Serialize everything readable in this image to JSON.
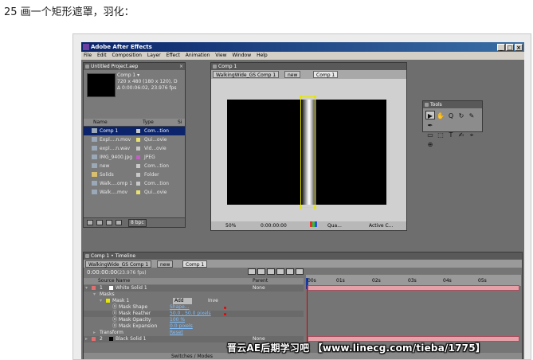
{
  "caption": "25 画一个矩形遮罩，羽化：",
  "app": {
    "title": "Adobe After Effects",
    "window_buttons": [
      "_",
      "□",
      "×"
    ],
    "menu": [
      "File",
      "Edit",
      "Composition",
      "Layer",
      "Effect",
      "Animation",
      "View",
      "Window",
      "Help"
    ]
  },
  "project": {
    "title": "Untitled Project.aep",
    "close": "×",
    "selected_name": "Comp 1 ▾",
    "info_lines": [
      "720 x 480  (180 x 120), D",
      "Δ 0:00:06:02, 23.976 fps"
    ],
    "columns": [
      "Name",
      "Type",
      "Si"
    ],
    "items": [
      {
        "name": "Comp 1",
        "type": "Com...tion",
        "label_color": "#c8c8c8"
      },
      {
        "name": "Expl....n.mov",
        "type": "Qui...ovie",
        "label_color": "#e8e070"
      },
      {
        "name": "expl....n.wav",
        "type": "Vid...ovie",
        "label_color": "#c8c8c8"
      },
      {
        "name": "IMG_9400.jpg",
        "type": "JPEG",
        "label_color": "#c060c0"
      },
      {
        "name": "new",
        "type": "Com...tion",
        "label_color": "#c8c8c8"
      },
      {
        "name": "Solids",
        "type": "Folder",
        "label_color": "#c8c8c8"
      },
      {
        "name": "Walk....omp 1",
        "type": "Com...tion",
        "label_color": "#c8c8c8"
      },
      {
        "name": "Walk....mov",
        "type": "Qui...ovie",
        "label_color": "#e8e070"
      }
    ],
    "bpc": "8 bpc"
  },
  "viewer": {
    "title": "Comp 1",
    "tabs": [
      "WalkingWide_GS Comp 1",
      "new",
      "Comp 1"
    ],
    "zoom": "50%",
    "timecode": "0:00:00:00",
    "resolution": "Qua...",
    "camera": "Active C..."
  },
  "tools": {
    "title": "Tools",
    "icons": [
      "▶",
      "✋",
      "Q",
      "↻",
      "✎",
      "✒",
      "▭",
      "⬚",
      "T",
      "✍",
      "⌖",
      "⊕"
    ]
  },
  "timeline": {
    "title": "Comp 1 • Timeline",
    "tabs": [
      "WalkingWide_GS Comp 1",
      "new",
      "Comp 1"
    ],
    "timecode": "0:00:00:00",
    "fps": "(23.976 fps)",
    "header": {
      "source_name": "Source Name",
      "parent": "Parent"
    },
    "ruler": [
      "00s",
      "01s",
      "02s",
      "03s",
      "04s",
      "05s"
    ],
    "rows": [
      {
        "num": "1",
        "name": "White Solid 1",
        "parent": "None"
      },
      {
        "label": "Masks"
      },
      {
        "label": "Mask 1",
        "mode": "Add",
        "invert": "Inve"
      },
      {
        "label": "Mask Shape",
        "value": "Shape..."
      },
      {
        "label": "Mask Feather",
        "value": "50.0 , 50.0 pixels"
      },
      {
        "label": "Mask Opacity",
        "value": "100 %"
      },
      {
        "label": "Mask Expansion",
        "value": "0.0 pixels"
      },
      {
        "label": "Transform",
        "value": "Reset"
      },
      {
        "num": "2",
        "name": "Black Solid 1",
        "parent": "None"
      }
    ],
    "footer": "Switches / Modes"
  },
  "watermark": "晋云AE后期学习吧 【www.linecg.com/tieba/1775】"
}
